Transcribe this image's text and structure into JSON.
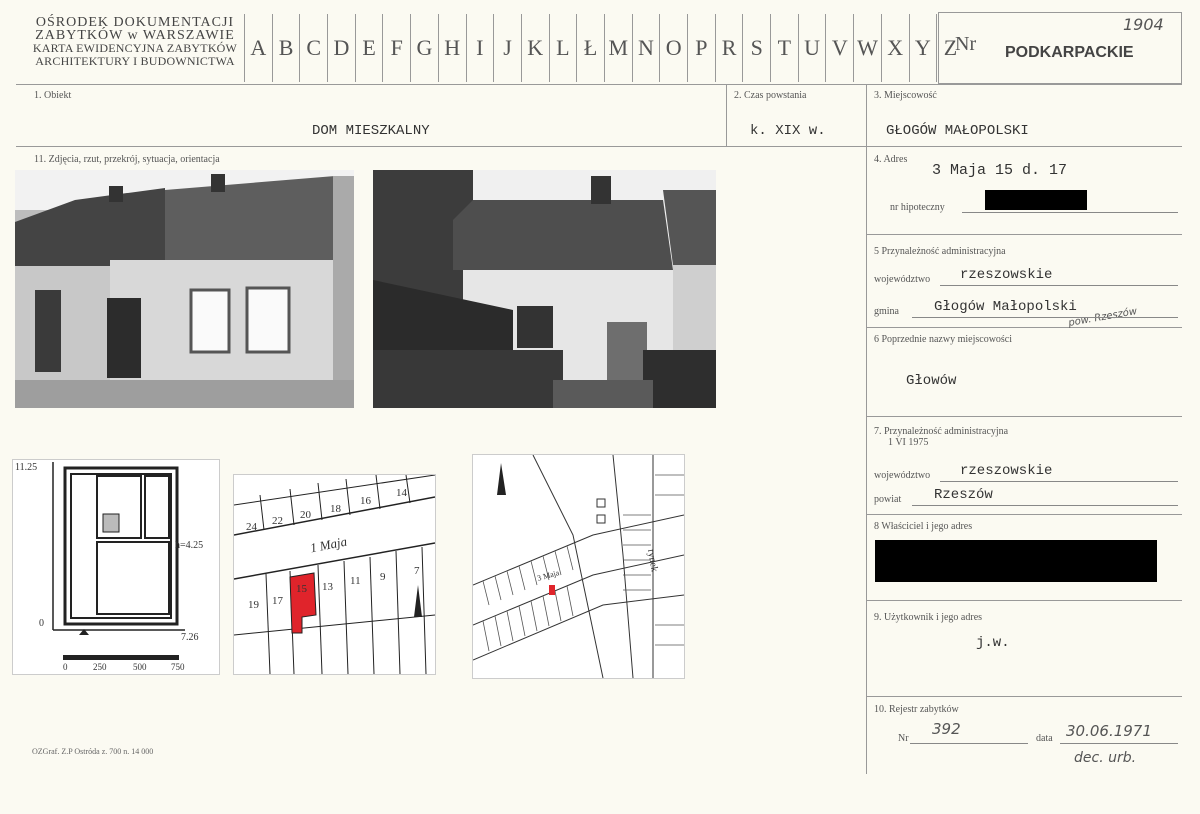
{
  "header": {
    "inst_1": "OŚRODEK DOKUMENTACJI",
    "inst_2": "ZABYTKÓW w WARSZAWIE",
    "inst_3": "KARTA EWIDENCYJNA ZABYTKÓW",
    "inst_4": "ARCHITEKTURY I BUDOWNICTWA",
    "letters": [
      "A",
      "B",
      "C",
      "D",
      "E",
      "F",
      "G",
      "H",
      "I",
      "J",
      "K",
      "L",
      "Ł",
      "M",
      "N",
      "O",
      "P",
      "R",
      "S",
      "T",
      "U",
      "V",
      "W",
      "X",
      "Y",
      "Z"
    ],
    "nr_label": "Nr",
    "nr_value": "1904",
    "region": "PODKARPACKIE"
  },
  "fields": {
    "obiekt_label": "1. Obiekt",
    "obiekt_value": "DOM MIESZKALNY",
    "czas_label": "2. Czas powstania",
    "czas_value": "k. XIX w.",
    "miejscowosc_label": "3. Miejscowość",
    "miejscowosc_value": "GŁOGÓW MAŁOPOLSKI",
    "zdjecia_label": "11. Zdjęcia, rzut, przekrój, sytuacja, orientacja",
    "adres_label": "4. Adres",
    "adres_value": "3 Maja 15 d. 17",
    "hipoteczny_label": "nr hipoteczny",
    "przyn_label": "5 Przynależność administracyjna",
    "woj_label": "województwo",
    "woj_value": "rzeszowskie",
    "gmina_label": "gmina",
    "gmina_value": "Głogów Małopolski",
    "gmina_note": "pow. Rzeszów",
    "poprz_label": "6 Poprzednie nazwy miejscowości",
    "poprz_value": "Głowów",
    "przyn75_label": "7. Przynależność administracyjna",
    "przyn75_sub": "1 VI 1975",
    "woj75_label": "województwo",
    "woj75_value": "rzeszowskie",
    "powiat_label": "powiat",
    "powiat_value": "Rzeszów",
    "wlasciciel_label": "8 Właściciel i jego adres",
    "uzytkownik_label": "9. Użytkownik i jego adres",
    "uzytkownik_value": "j.w.",
    "rejestr_label": "10. Rejestr zabytków",
    "rejestr_nr_label": "Nr",
    "rejestr_nr_value": "392",
    "rejestr_data_label": "data",
    "rejestr_data_value": "30.06.1971",
    "rejestr_note": "dec. urb.",
    "footer": "OZGraf. Z.P Ostróda z. 700 n. 14 000"
  },
  "plan": {
    "dim_top": "11.25",
    "dim_side": "h=4.25",
    "dim_zero": "0",
    "dim_right": "7.26",
    "scale": [
      "0",
      "250",
      "500",
      "750"
    ]
  },
  "street_map": {
    "street": "1 Maja",
    "north_numbers": [
      "24",
      "22",
      "20",
      "18",
      "16",
      "14"
    ],
    "south_numbers": [
      "19",
      "17",
      "15",
      "13",
      "11",
      "9",
      "7"
    ],
    "highlight": "#e0242b"
  },
  "town_map": {
    "label_rynek": "rynek",
    "label_street": "3 Maja",
    "highlight": "#e0242b"
  }
}
